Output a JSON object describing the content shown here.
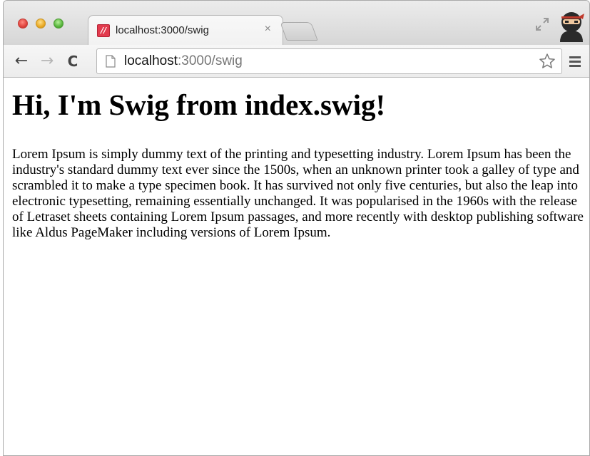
{
  "browser": {
    "tab": {
      "title": "localhost:3000/swig",
      "favicon_text": "//",
      "close_label": "×"
    },
    "address": {
      "host": "localhost",
      "rest": ":3000/swig"
    },
    "nav": {
      "back": "←",
      "forward": "→",
      "reload": "C"
    },
    "colors": {
      "favicon": "#e23b4e",
      "close_red": "#e0443e",
      "minimize_yellow": "#e9a925",
      "zoom_green": "#57b53c"
    },
    "icons": [
      "window-close-icon",
      "window-minimize-icon",
      "window-zoom-icon",
      "fullscreen-icon",
      "user-avatar-icon",
      "page-icon",
      "star-icon",
      "menu-icon"
    ]
  },
  "page": {
    "heading": "Hi, I'm Swig from index.swig!",
    "paragraph": "Lorem Ipsum is simply dummy text of the printing and typesetting industry. Lorem Ipsum has been the industry's standard dummy text ever since the 1500s, when an unknown printer took a galley of type and scrambled it to make a type specimen book. It has survived not only five centuries, but also the leap into electronic typesetting, remaining essentially unchanged. It was popularised in the 1960s with the release of Letraset sheets containing Lorem Ipsum passages, and more recently with desktop publishing software like Aldus PageMaker including versions of Lorem Ipsum."
  }
}
